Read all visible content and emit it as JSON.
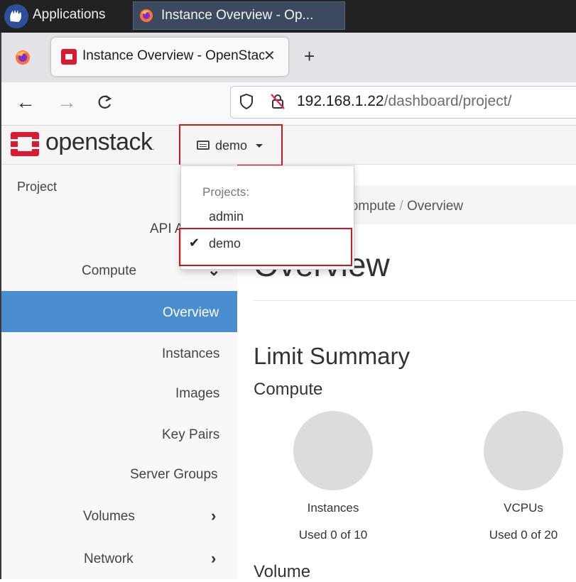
{
  "taskbar": {
    "applications_label": "Applications",
    "window_task_label": "Instance Overview - Op..."
  },
  "browser": {
    "tab_title": "Instance Overview - OpenStack Dashboard",
    "url_host": "192.168.1.22",
    "url_path": "/dashboard/project/"
  },
  "header": {
    "brand": "openstack",
    "brand_mark": ".",
    "project_selector": "demo"
  },
  "dropdown": {
    "header": "Projects:",
    "items": [
      {
        "label": "admin",
        "selected": false
      },
      {
        "label": "demo",
        "selected": true
      }
    ]
  },
  "sidebar": {
    "project": "Project",
    "api_access": "API Access",
    "compute": "Compute",
    "overview": "Overview",
    "instances": "Instances",
    "images": "Images",
    "key_pairs": "Key Pairs",
    "server_groups": "Server Groups",
    "volumes": "Volumes",
    "network": "Network"
  },
  "breadcrumb": {
    "compute": "Compute",
    "separator": "/",
    "overview": "Overview"
  },
  "main": {
    "title": "Overview",
    "limit_summary": "Limit Summary",
    "compute_heading": "Compute",
    "charts": [
      {
        "label": "Instances",
        "usage": "Used 0 of 10"
      },
      {
        "label": "VCPUs",
        "usage": "Used 0 of 20"
      }
    ],
    "volume_heading": "Volume"
  },
  "colors": {
    "accent": "#4a8ed0",
    "highlight_outline": "#d0171b",
    "openstack_red": "#da1a32"
  }
}
